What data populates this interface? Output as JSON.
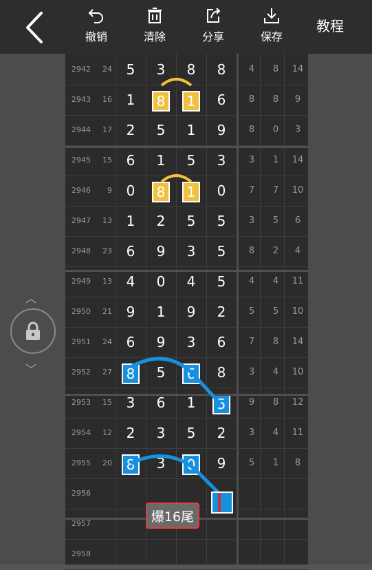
{
  "toolbar": {
    "undo_label": "撤销",
    "clear_label": "清除",
    "share_label": "分享",
    "save_label": "保存",
    "tutorial_label": "教程"
  },
  "rows": [
    {
      "period": "2942",
      "sum": "24",
      "digits": [
        "5",
        "3",
        "8",
        "8"
      ],
      "stats": [
        "4",
        "8",
        "14"
      ],
      "hl": [
        "",
        "",
        "",
        ""
      ]
    },
    {
      "period": "2943",
      "sum": "16",
      "digits": [
        "1",
        "8",
        "1",
        "6"
      ],
      "stats": [
        "8",
        "8",
        "9"
      ],
      "hl": [
        "",
        "y",
        "y",
        ""
      ]
    },
    {
      "period": "2944",
      "sum": "17",
      "digits": [
        "2",
        "5",
        "1",
        "9"
      ],
      "stats": [
        "8",
        "0",
        "3"
      ],
      "hl": [
        "",
        "",
        "",
        ""
      ]
    },
    {
      "period": "2945",
      "sum": "15",
      "digits": [
        "6",
        "1",
        "5",
        "3"
      ],
      "stats": [
        "3",
        "1",
        "14"
      ],
      "hl": [
        "",
        "",
        "",
        ""
      ]
    },
    {
      "period": "2946",
      "sum": "9",
      "digits": [
        "0",
        "8",
        "1",
        "0"
      ],
      "stats": [
        "7",
        "7",
        "10"
      ],
      "hl": [
        "",
        "y",
        "y",
        ""
      ]
    },
    {
      "period": "2947",
      "sum": "13",
      "digits": [
        "1",
        "2",
        "5",
        "5"
      ],
      "stats": [
        "3",
        "5",
        "6"
      ],
      "hl": [
        "",
        "",
        "",
        ""
      ]
    },
    {
      "period": "2948",
      "sum": "23",
      "digits": [
        "6",
        "9",
        "3",
        "5"
      ],
      "stats": [
        "8",
        "2",
        "4"
      ],
      "hl": [
        "",
        "",
        "",
        ""
      ]
    },
    {
      "period": "2949",
      "sum": "13",
      "digits": [
        "4",
        "0",
        "4",
        "5"
      ],
      "stats": [
        "4",
        "4",
        "11"
      ],
      "hl": [
        "",
        "",
        "",
        ""
      ]
    },
    {
      "period": "2950",
      "sum": "21",
      "digits": [
        "9",
        "1",
        "9",
        "2"
      ],
      "stats": [
        "5",
        "5",
        "10"
      ],
      "hl": [
        "",
        "",
        "",
        ""
      ]
    },
    {
      "period": "2951",
      "sum": "24",
      "digits": [
        "6",
        "9",
        "3",
        "6"
      ],
      "stats": [
        "7",
        "8",
        "14"
      ],
      "hl": [
        "",
        "",
        "",
        ""
      ]
    },
    {
      "period": "2952",
      "sum": "27",
      "digits": [
        "8",
        "5",
        "6",
        "8"
      ],
      "stats": [
        "3",
        "4",
        "10"
      ],
      "hl": [
        "b",
        "",
        "b",
        ""
      ]
    },
    {
      "period": "2953",
      "sum": "15",
      "digits": [
        "3",
        "6",
        "1",
        "5"
      ],
      "stats": [
        "9",
        "8",
        "12"
      ],
      "hl": [
        "",
        "",
        "",
        "b"
      ]
    },
    {
      "period": "2954",
      "sum": "12",
      "digits": [
        "2",
        "3",
        "5",
        "2"
      ],
      "stats": [
        "3",
        "4",
        "11"
      ],
      "hl": [
        "",
        "",
        "",
        ""
      ]
    },
    {
      "period": "2955",
      "sum": "20",
      "digits": [
        "8",
        "3",
        "0",
        "9"
      ],
      "stats": [
        "5",
        "1",
        "8"
      ],
      "hl": [
        "b",
        "",
        "b",
        ""
      ]
    },
    {
      "period": "2956",
      "sum": "",
      "digits": [
        "",
        "",
        "",
        ""
      ],
      "stats": [
        "",
        "",
        ""
      ],
      "hl": [
        "",
        "",
        "",
        ""
      ]
    },
    {
      "period": "2957",
      "sum": "",
      "digits": [
        "",
        "",
        "",
        ""
      ],
      "stats": [
        "",
        "",
        ""
      ],
      "hl": [
        "",
        "",
        "",
        ""
      ]
    },
    {
      "period": "2958",
      "sum": "",
      "digits": [
        "",
        "",
        "",
        ""
      ],
      "stats": [
        "",
        "",
        ""
      ],
      "hl": [
        "",
        "",
        "",
        ""
      ]
    }
  ],
  "annotation": {
    "label": "爆16尾"
  },
  "colors": {
    "highlight_yellow": "#f0c040",
    "highlight_blue": "#1890e0",
    "badge_border": "#e04040"
  },
  "icons": [
    "back-arrow-icon",
    "undo-icon",
    "trash-icon",
    "share-icon",
    "download-icon",
    "lock-icon"
  ]
}
